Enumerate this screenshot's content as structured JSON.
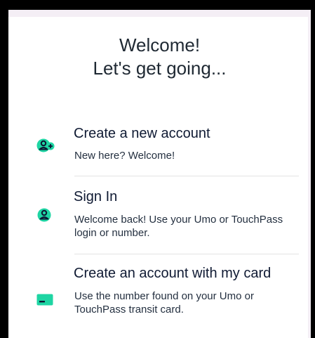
{
  "header": {
    "line1": "Welcome!",
    "line2": "Let's get going..."
  },
  "options": [
    {
      "title": "Create a new account",
      "description": "New here? Welcome!",
      "icon": "add-user-icon"
    },
    {
      "title": "Sign In",
      "description": "Welcome back! Use your Umo or TouchPass login or number.",
      "icon": "user-icon"
    },
    {
      "title": "Create an account with my card",
      "description": "Use the number found on your Umo or TouchPass transit card.",
      "icon": "card-icon"
    }
  ],
  "colors": {
    "accent": "#1ed5a3",
    "icon_ink": "#0c1633",
    "title_text": "#0f1a33",
    "divider": "#e3e3e3"
  }
}
